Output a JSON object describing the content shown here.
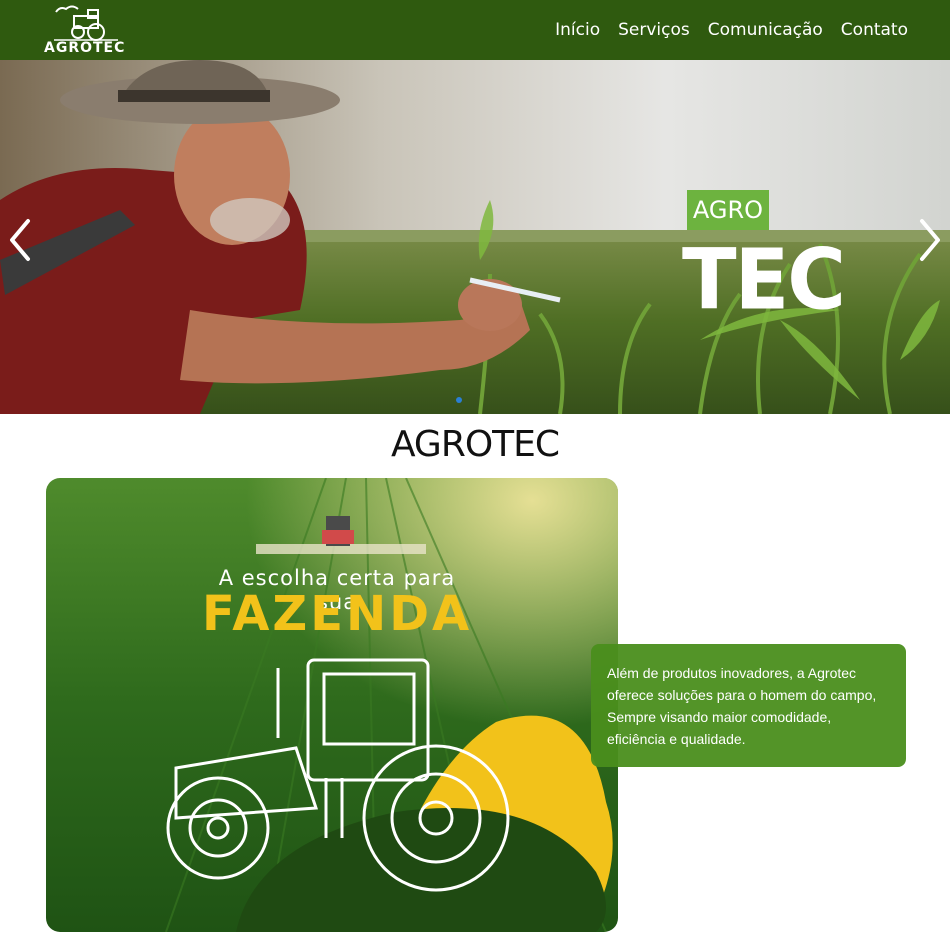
{
  "brand": {
    "logo_text": "AGROTEC"
  },
  "nav": {
    "items": [
      {
        "label": "Início"
      },
      {
        "label": "Serviços"
      },
      {
        "label": "Comunicação"
      },
      {
        "label": "Contato"
      }
    ]
  },
  "hero": {
    "badge": "AGRO",
    "title": "TEC",
    "slide_count": 1
  },
  "section": {
    "title": "AGROTEC"
  },
  "promo": {
    "tagline": "A escolha certa para sua",
    "headline": "FAZENDA"
  },
  "info_card": {
    "text": "Além de produtos inovadores, a Agrotec oferece soluções para o homem do campo, Sempre visando maior comodidade, eficiência e qualidade."
  },
  "colors": {
    "navbar": "#2f5a0f",
    "accent_green": "#6db33f",
    "card_green": "#4a8e1c",
    "headline_yellow": "#f2c21a"
  }
}
